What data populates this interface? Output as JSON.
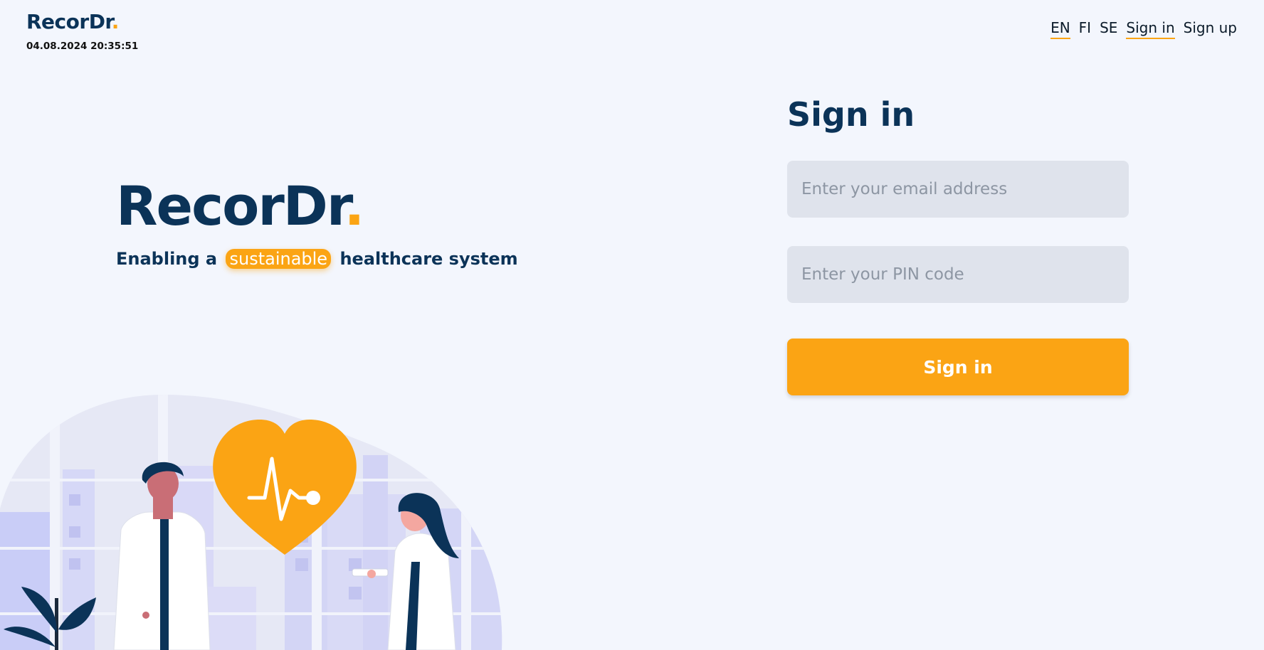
{
  "header": {
    "logo_text": "RecorDr",
    "logo_dot": ".",
    "datetime": "04.08.2024 20:35:51"
  },
  "nav": {
    "lang_en": "EN",
    "lang_fi": "FI",
    "lang_se": "SE",
    "sign_in": "Sign in",
    "sign_up": "Sign up"
  },
  "hero": {
    "title": "RecorDr",
    "title_dot": ".",
    "subtitle_before": "Enabling a",
    "subtitle_highlight": "sustainable",
    "subtitle_after": "healthcare system"
  },
  "form": {
    "title": "Sign in",
    "email_placeholder": "Enter your email address",
    "pin_placeholder": "Enter your PIN code",
    "submit_label": "Sign in"
  },
  "colors": {
    "brand_navy": "#0b3358",
    "accent_orange": "#fba414",
    "background": "#f3f6fd",
    "input_bg": "#dfe3ec"
  }
}
